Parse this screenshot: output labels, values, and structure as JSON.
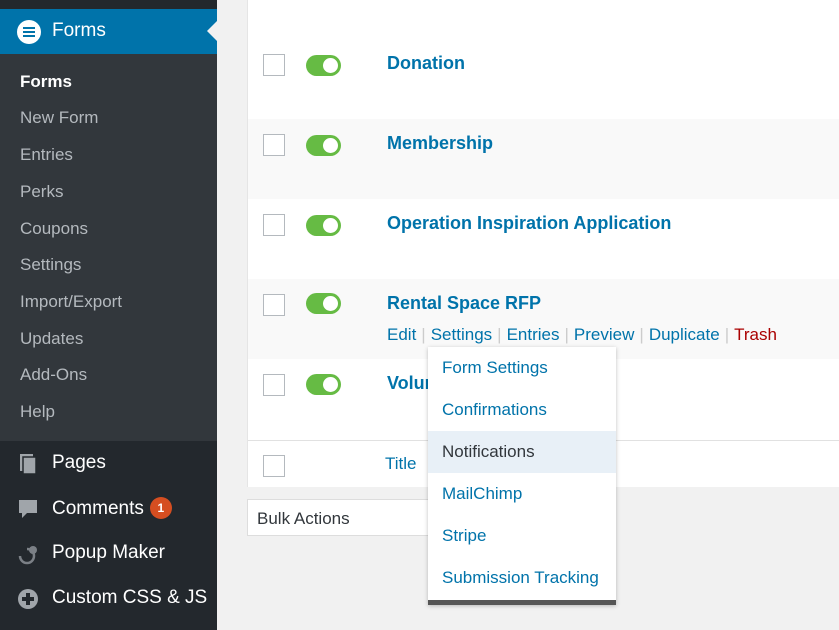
{
  "sidebar": {
    "active_menu": "Forms",
    "forms_submenu": [
      "Forms",
      "New Form",
      "Entries",
      "Perks",
      "Coupons",
      "Settings",
      "Import/Export",
      "Updates",
      "Add-Ons",
      "Help"
    ],
    "pages": "Pages",
    "comments": "Comments",
    "comments_badge": "1",
    "popup_maker": "Popup Maker",
    "custom_css": "Custom CSS & JS"
  },
  "forms": {
    "rows": [
      "Donation",
      "Membership",
      "Operation Inspiration Application",
      "Rental Space RFP",
      "Volunteer"
    ],
    "row_actions": {
      "edit": "Edit",
      "settings": "Settings",
      "entries": "Entries",
      "preview": "Preview",
      "duplicate": "Duplicate",
      "trash": "Trash"
    },
    "footer_title": "Title"
  },
  "bulk_actions": "Bulk Actions",
  "settings_dropdown": [
    "Form Settings",
    "Confirmations",
    "Notifications",
    "MailChimp",
    "Stripe",
    "Submission Tracking"
  ],
  "colors": {
    "sidebar_bg": "#23282d",
    "submenu_bg": "#32373c",
    "active_bg": "#0073aa",
    "link": "#0073aa",
    "toggle_on": "#66bb44",
    "trash": "#a00",
    "badge": "#d54e21"
  }
}
